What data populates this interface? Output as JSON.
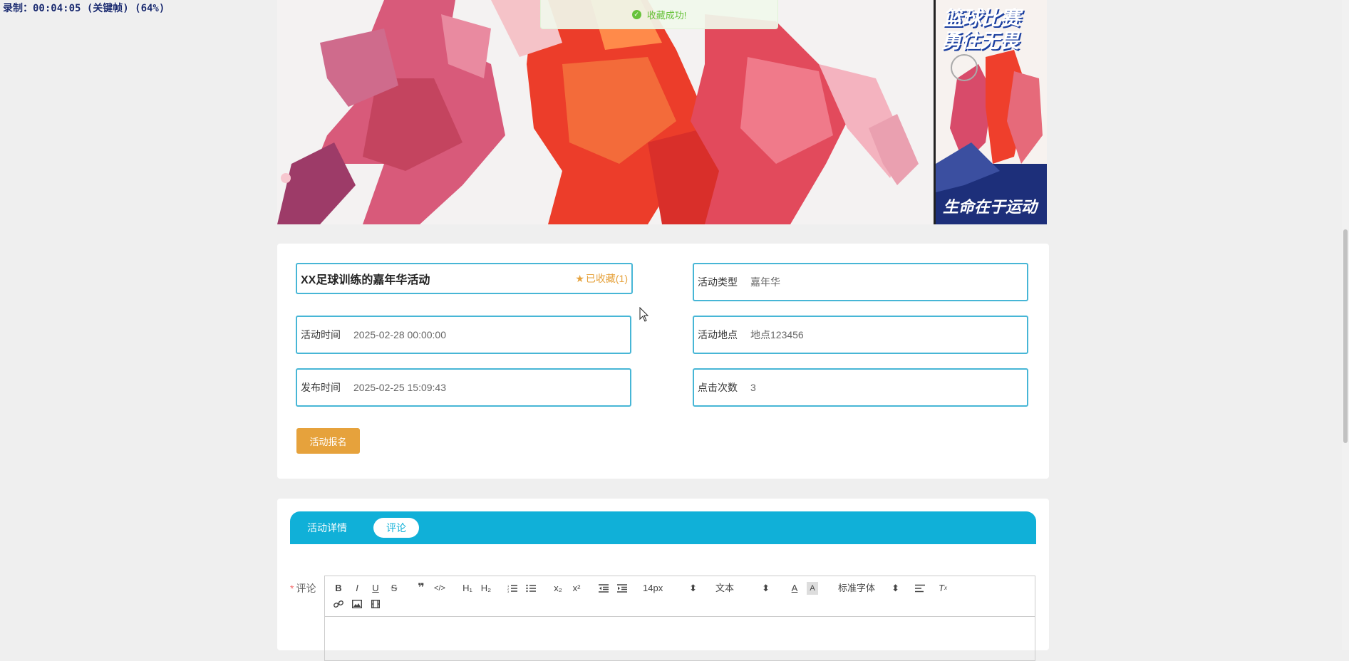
{
  "recording_overlay": "录制：00:04:05 (关键帧) (64%)",
  "toast": {
    "text": "收藏成功!",
    "icon": "success-check-icon",
    "color": "#67c23a"
  },
  "side_poster": {
    "line1": "篮球比赛",
    "line2": "勇往无畏",
    "footer": "生命在于运动"
  },
  "activity": {
    "title": "XX足球训练的嘉年华活动",
    "favorite_label": "已收藏(1)",
    "favorite_icon": "star-icon",
    "fields": {
      "type": {
        "label": "活动类型",
        "value": "嘉年华"
      },
      "time": {
        "label": "活动时间",
        "value": "2025-02-28 00:00:00"
      },
      "location": {
        "label": "活动地点",
        "value": "地点123456"
      },
      "publish_time": {
        "label": "发布时间",
        "value": "2025-02-25 15:09:43"
      },
      "clicks": {
        "label": "点击次数",
        "value": "3"
      }
    },
    "signup_button": "活动报名"
  },
  "tabs": [
    {
      "label": "活动详情",
      "active": false
    },
    {
      "label": "评论",
      "active": true
    }
  ],
  "comment": {
    "label": "评论",
    "required_mark": "*",
    "toolbar": {
      "font_size": "14px",
      "format": "文本",
      "font_family": "标准字体",
      "buttons": [
        "bold",
        "italic",
        "underline",
        "strike",
        "blockquote",
        "code-block",
        "header-1",
        "header-2",
        "ordered-list",
        "bullet-list",
        "subscript",
        "superscript",
        "indent-decrease",
        "indent-increase",
        "font-color",
        "background-color",
        "align",
        "clean",
        "link",
        "image",
        "video"
      ]
    }
  },
  "colors": {
    "accent": "#10b0d8",
    "field_border": "#47b6d6",
    "button": "#e6a23c",
    "favorite": "#e6a23c"
  }
}
